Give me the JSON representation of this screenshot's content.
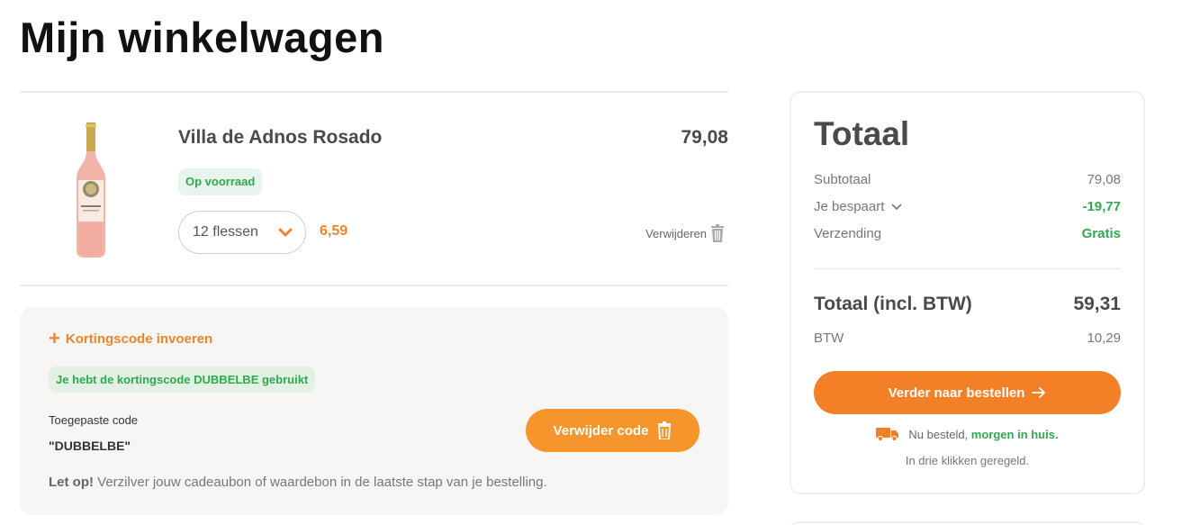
{
  "page": {
    "title": "Mijn winkelwagen"
  },
  "cart_item": {
    "name": "Villa de Adnos Rosado",
    "price": "79,08",
    "stock_badge": "Op voorraad",
    "quantity": "12 flessen",
    "unit_price": "6,59",
    "remove_label": "Verwijderen"
  },
  "discount": {
    "add_code_label": "Kortingscode invoeren",
    "used_notice": "Je hebt de kortingscode DUBBELBE gebruikt",
    "applied_label": "Toegepaste code",
    "applied_code": "\"DUBBELBE\"",
    "remove_button": "Verwijder code",
    "note_bold": "Let op!",
    "note_text": " Verzilver jouw cadeaubon of waardebon in de laatste stap van je bestelling."
  },
  "summary": {
    "title": "Totaal",
    "subtotal_label": "Subtotaal",
    "subtotal_value": "79,08",
    "savings_label": "Je bespaart",
    "savings_value": "-19,77",
    "shipping_label": "Verzending",
    "shipping_value": "Gratis",
    "total_label": "Totaal (incl. BTW)",
    "total_value": "59,31",
    "btw_label": "BTW",
    "btw_value": "10,29",
    "order_button": "Verder naar bestellen",
    "delivery_text": "Nu besteld,",
    "delivery_highlight": "morgen in huis.",
    "tagline": "In drie klikken geregeld."
  },
  "colors": {
    "accent_orange": "#f37f26",
    "success_green": "#2eaa4f",
    "panel_bg": "#f7f6f5"
  },
  "icons": {
    "bottle": "rose-wine-bottle-image",
    "chevron": "chevron-down-icon",
    "trash": "trash-icon",
    "plus": "plus-icon",
    "arrow": "arrow-right-icon",
    "truck": "truck-icon"
  }
}
